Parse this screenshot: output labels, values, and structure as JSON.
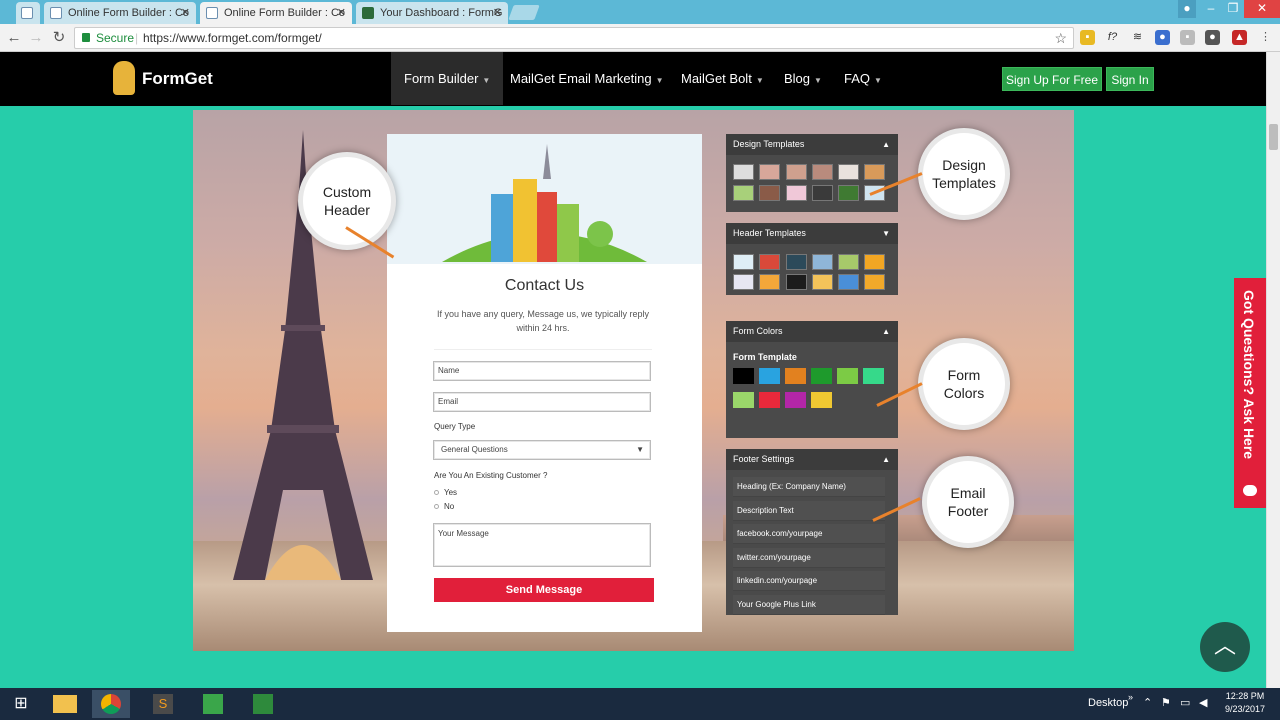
{
  "browser": {
    "tabs": [
      {
        "title": "Online Form Builder : Co",
        "active": false
      },
      {
        "title": "Online Form Builder : Co",
        "active": true
      },
      {
        "title": "Your Dashboard : FormG",
        "active": false
      }
    ],
    "secure_label": "Secure",
    "url": "https://www.formget.com/formget/"
  },
  "site": {
    "logo_text": "FormGet",
    "nav": [
      "Form Builder",
      "MailGet Email Marketing",
      "MailGet Bolt",
      "Blog",
      "FAQ"
    ],
    "signup_label": "Sign Up For Free",
    "signin_label": "Sign In"
  },
  "form": {
    "title": "Contact Us",
    "desc": "If you have any query, Message us, we typically reply within 24 hrs.",
    "name_placeholder": "Name",
    "email_placeholder": "Email",
    "query_label": "Query Type",
    "query_value": "General Questions",
    "existing_label": "Are You An Existing Customer ?",
    "yes_label": "Yes",
    "no_label": "No",
    "message_placeholder": "Your Message",
    "send_label": "Send Message"
  },
  "panels": {
    "design": "Design Templates",
    "header": "Header Templates",
    "colors": "Form Colors",
    "form_template": "Form Template",
    "footer": "Footer Settings",
    "footer_rows": [
      "Heading (Ex: Company Name)",
      "Description Text",
      "facebook.com/yourpage",
      "twitter.com/yourpage",
      "linkedin.com/yourpage",
      "Your Google Plus Link"
    ],
    "swatches_row1": [
      "#000000",
      "#29a3e0",
      "#e2811f",
      "#1e9a2c",
      "#7ccb45",
      "#36d98a"
    ],
    "swatches_row2": [
      "#9ad76a",
      "#e8293b",
      "#b326a8",
      "#f0c832"
    ]
  },
  "callouts": {
    "custom_header": "Custom Header",
    "design_templates": "Design Templates",
    "form_colors": "Form Colors",
    "email_footer": "Email Footer"
  },
  "ask_tab": "Got Questions? Ask Here",
  "taskbar": {
    "desktop_label": "Desktop",
    "time": "12:28 PM",
    "date": "9/23/2017"
  }
}
